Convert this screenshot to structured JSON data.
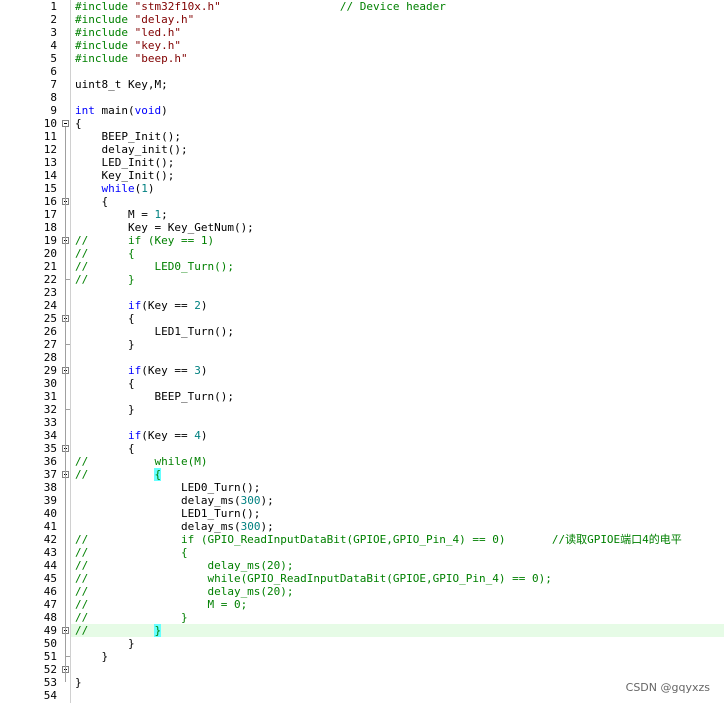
{
  "editor": {
    "lines": [
      [
        {
          "t": "#include ",
          "c": "pp"
        },
        {
          "t": "\"stm32f10x.h\"",
          "c": "str"
        },
        {
          "t": "                  // Device header",
          "c": "cm"
        }
      ],
      [
        {
          "t": "#include ",
          "c": "pp"
        },
        {
          "t": "\"delay.h\"",
          "c": "str"
        }
      ],
      [
        {
          "t": "#include ",
          "c": "pp"
        },
        {
          "t": "\"led.h\"",
          "c": "str"
        }
      ],
      [
        {
          "t": "#include ",
          "c": "pp"
        },
        {
          "t": "\"key.h\"",
          "c": "str"
        }
      ],
      [
        {
          "t": "#include ",
          "c": "pp"
        },
        {
          "t": "\"beep.h\"",
          "c": "str"
        }
      ],
      [],
      [
        {
          "t": "uint8_t Key,M;"
        }
      ],
      [],
      [
        {
          "t": "int",
          "c": "kw"
        },
        {
          "t": " main("
        },
        {
          "t": "void",
          "c": "kw"
        },
        {
          "t": ")"
        }
      ],
      [
        {
          "t": "{"
        }
      ],
      [
        {
          "t": "    BEEP_Init();"
        }
      ],
      [
        {
          "t": "    delay_init();"
        }
      ],
      [
        {
          "t": "    LED_Init();"
        }
      ],
      [
        {
          "t": "    Key_Init();"
        }
      ],
      [
        {
          "t": "    "
        },
        {
          "t": "while",
          "c": "kw"
        },
        {
          "t": "("
        },
        {
          "t": "1",
          "c": "n"
        },
        {
          "t": ")"
        }
      ],
      [
        {
          "t": "    {"
        }
      ],
      [
        {
          "t": "        M = "
        },
        {
          "t": "1",
          "c": "n"
        },
        {
          "t": ";"
        }
      ],
      [
        {
          "t": "        Key = Key_GetNum();"
        }
      ],
      [
        {
          "t": "//      if (Key == 1)",
          "c": "cm"
        }
      ],
      [
        {
          "t": "//      {",
          "c": "cm"
        }
      ],
      [
        {
          "t": "//          LED0_Turn();",
          "c": "cm"
        }
      ],
      [
        {
          "t": "//      }",
          "c": "cm"
        }
      ],
      [],
      [
        {
          "t": "        "
        },
        {
          "t": "if",
          "c": "kw"
        },
        {
          "t": "(Key == "
        },
        {
          "t": "2",
          "c": "n"
        },
        {
          "t": ")"
        }
      ],
      [
        {
          "t": "        {"
        }
      ],
      [
        {
          "t": "            LED1_Turn();"
        }
      ],
      [
        {
          "t": "        }"
        }
      ],
      [],
      [
        {
          "t": "        "
        },
        {
          "t": "if",
          "c": "kw"
        },
        {
          "t": "(Key == "
        },
        {
          "t": "3",
          "c": "n"
        },
        {
          "t": ")"
        }
      ],
      [
        {
          "t": "        {"
        }
      ],
      [
        {
          "t": "            BEEP_Turn();"
        }
      ],
      [
        {
          "t": "        }"
        }
      ],
      [],
      [
        {
          "t": "        "
        },
        {
          "t": "if",
          "c": "kw"
        },
        {
          "t": "(Key == "
        },
        {
          "t": "4",
          "c": "n"
        },
        {
          "t": ")"
        }
      ],
      [
        {
          "t": "        {"
        }
      ],
      [
        {
          "t": "//          while(M)",
          "c": "cm"
        }
      ],
      [
        {
          "t": "//          ",
          "c": "cm"
        },
        {
          "t": "{",
          "c": "cm brk"
        }
      ],
      [
        {
          "t": "                LED0_Turn();"
        }
      ],
      [
        {
          "t": "                delay_ms("
        },
        {
          "t": "300",
          "c": "n"
        },
        {
          "t": ");"
        }
      ],
      [
        {
          "t": "                LED1_Turn();"
        }
      ],
      [
        {
          "t": "                delay_ms("
        },
        {
          "t": "300",
          "c": "n"
        },
        {
          "t": ");"
        }
      ],
      [
        {
          "t": "//              if (GPIO_ReadInputDataBit(GPIOE,GPIO_Pin_4) == 0)       //读取GPIOE端口4的电平",
          "c": "cm"
        }
      ],
      [
        {
          "t": "//              {",
          "c": "cm"
        }
      ],
      [
        {
          "t": "//                  delay_ms(20);",
          "c": "cm"
        }
      ],
      [
        {
          "t": "//                  while(GPIO_ReadInputDataBit(GPIOE,GPIO_Pin_4) == 0);",
          "c": "cm"
        }
      ],
      [
        {
          "t": "//                  delay_ms(20);",
          "c": "cm"
        }
      ],
      [
        {
          "t": "//                  M = 0;",
          "c": "cm"
        }
      ],
      [
        {
          "t": "//              }",
          "c": "cm"
        }
      ],
      [
        {
          "t": "//          ",
          "c": "cm"
        },
        {
          "t": "}",
          "c": "cm brk"
        }
      ],
      [
        {
          "t": "        }"
        }
      ],
      [
        {
          "t": "    }"
        }
      ],
      [],
      [
        {
          "t": "}"
        }
      ],
      []
    ],
    "highlighted_line": 49,
    "fold_markers": [
      10,
      16,
      19,
      25,
      29,
      35,
      37,
      49,
      52
    ]
  },
  "watermark": "CSDN @gqyxzs"
}
